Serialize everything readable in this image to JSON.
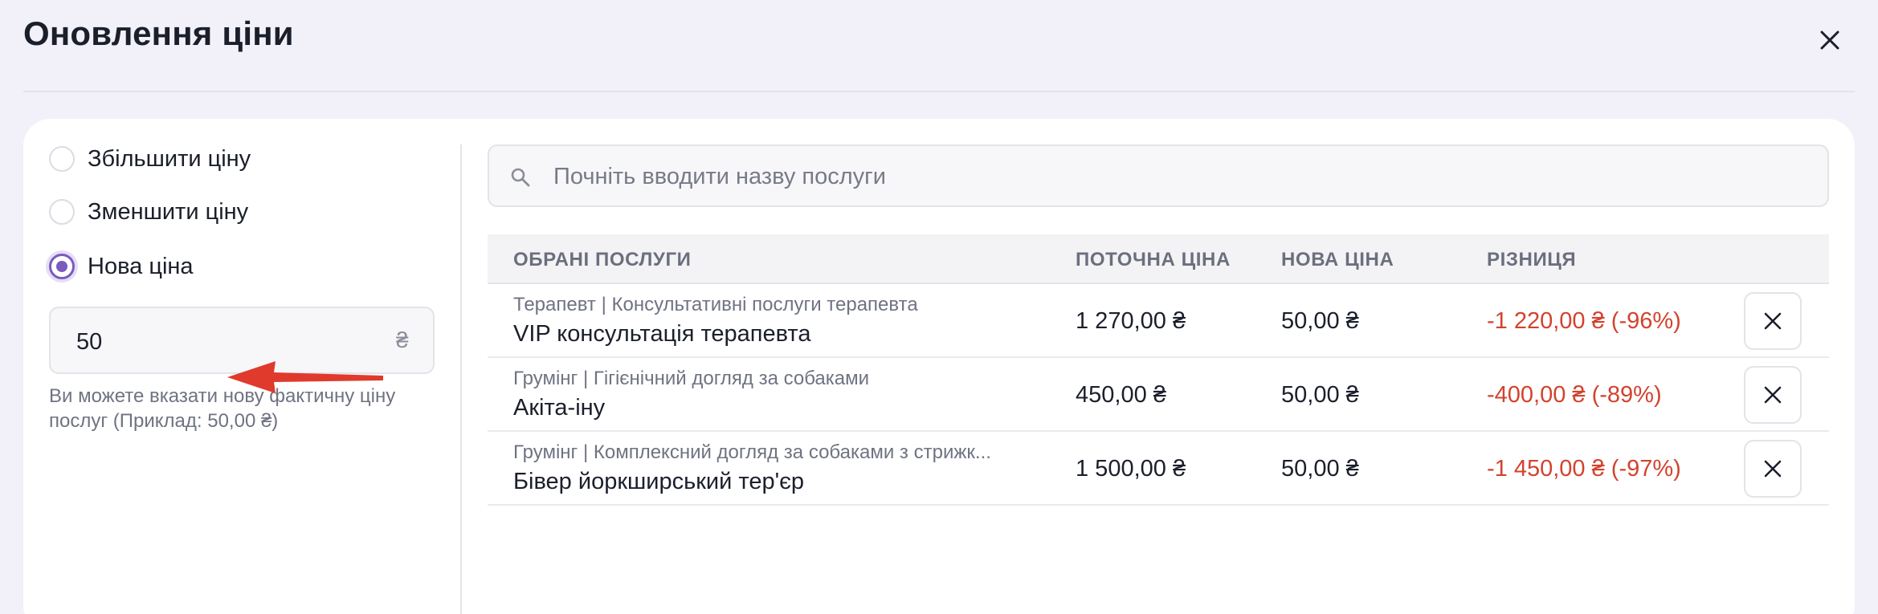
{
  "modal": {
    "title": "Оновлення ціни"
  },
  "options": {
    "increase_label": "Збільшити ціну",
    "decrease_label": "Зменшити ціну",
    "new_price_label": "Нова ціна",
    "selected": "new_price"
  },
  "price_input": {
    "value": "50",
    "currency": "₴",
    "hint": "Ви можете вказати нову фактичну ціну послуг (Приклад: 50,00 ₴)"
  },
  "search": {
    "placeholder": "Почніть вводити назву послуги"
  },
  "table": {
    "headers": {
      "service": "ОБРАНІ ПОСЛУГИ",
      "current": "ПОТОЧНА ЦІНА",
      "new": "НОВА ЦІНА",
      "difference": "РІЗНИЦЯ"
    },
    "rows": [
      {
        "category": "Терапевт | Консультативні послуги терапевта",
        "service": "VIP консультація терапевта",
        "current": "1 270,00 ₴",
        "new": "50,00 ₴",
        "difference": "-1 220,00 ₴ (-96%)"
      },
      {
        "category": "Грумінг | Гігієнічний догляд за собаками",
        "service": "Акіта-іну",
        "current": "450,00 ₴",
        "new": "50,00 ₴",
        "difference": "-400,00 ₴ (-89%)"
      },
      {
        "category": "Грумінг | Комплексний догляд за собаками з стрижк...",
        "service": "Бівер йоркширський тер'єр",
        "current": "1 500,00 ₴",
        "new": "50,00 ₴",
        "difference": "-1 450,00 ₴ (-97%)"
      }
    ]
  },
  "colors": {
    "accent": "#7a5bbe",
    "negative": "#d2432e",
    "annotation_arrow": "#e03a2c"
  },
  "icons": {
    "close": "close-icon",
    "search": "search-icon",
    "remove": "remove-icon"
  }
}
